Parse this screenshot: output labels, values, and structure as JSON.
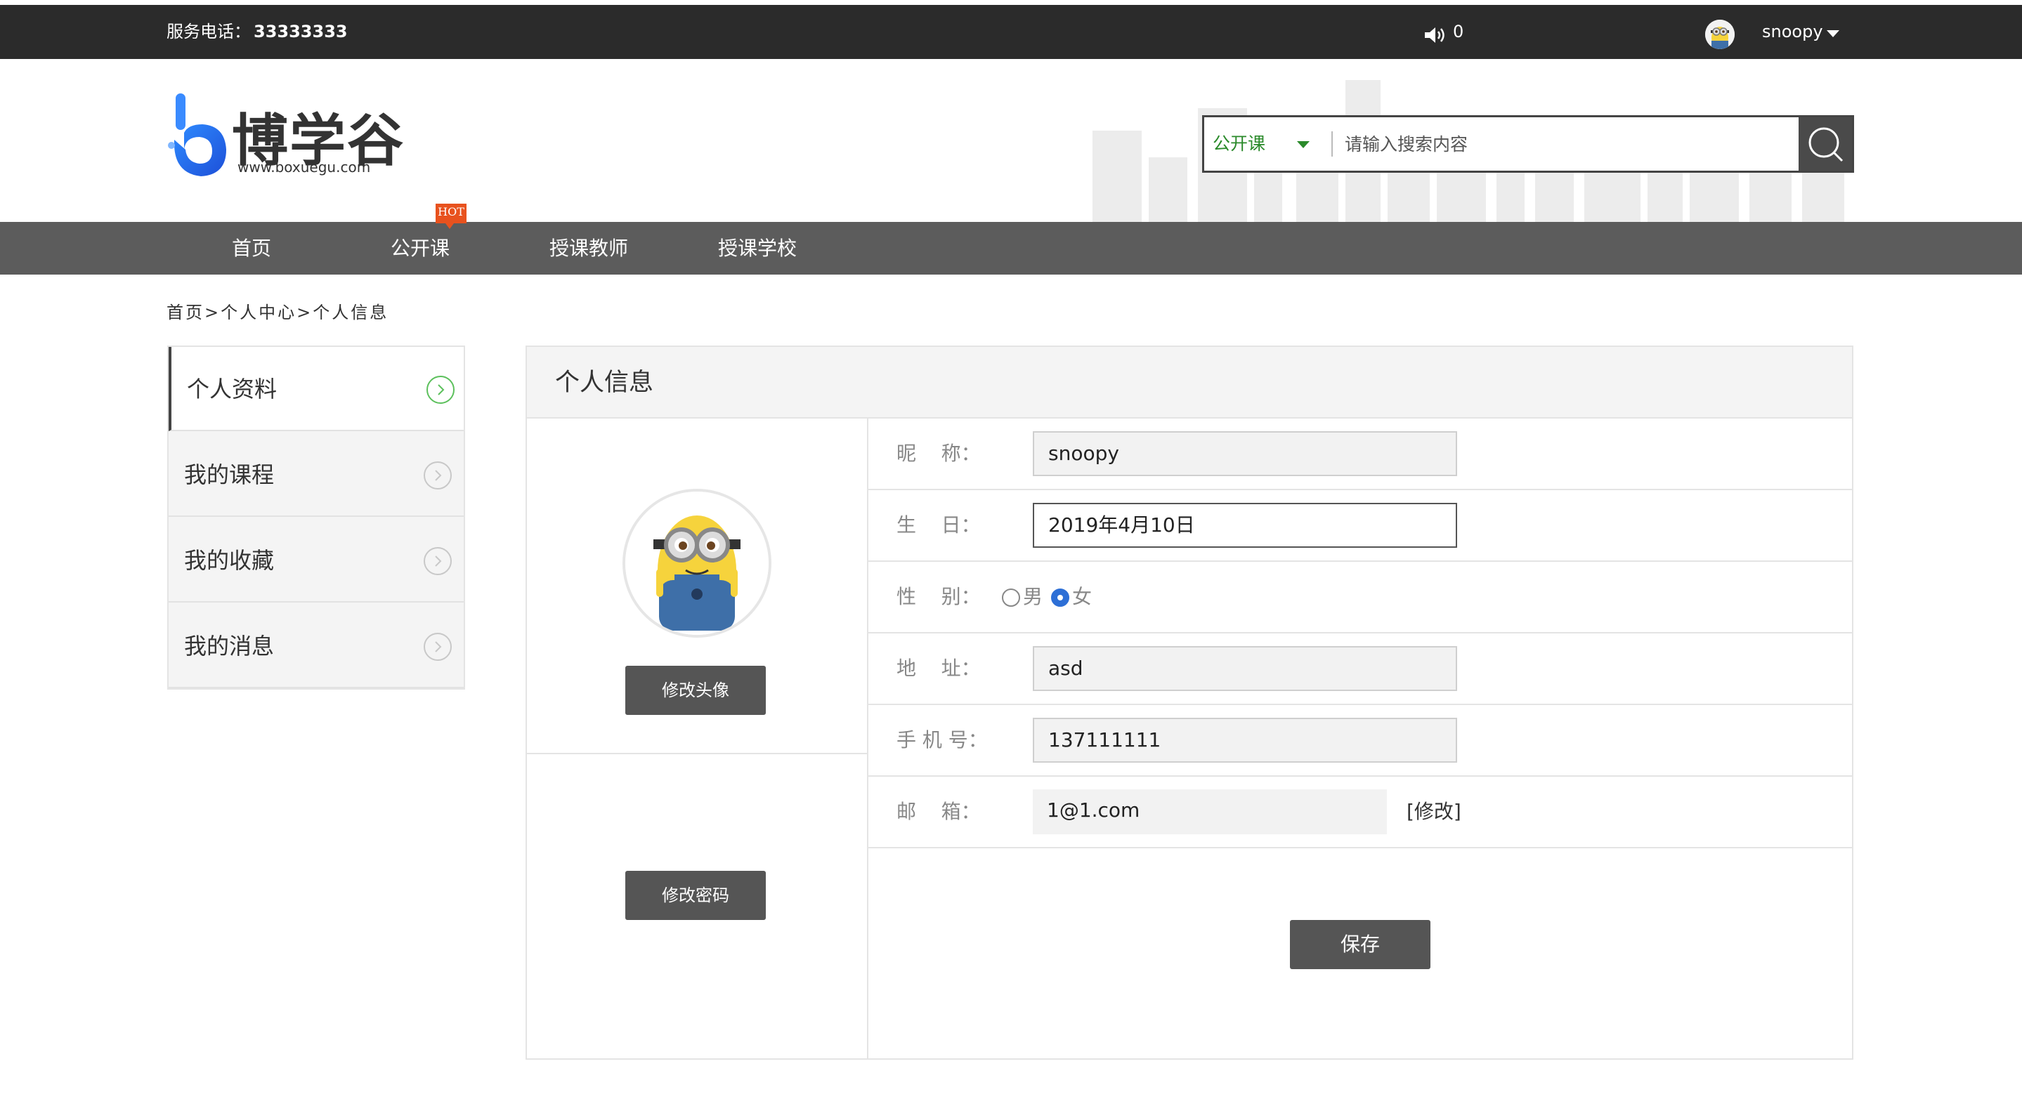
{
  "topbar": {
    "phone_label": "服务电话：",
    "phone_number": "33333333",
    "message_count": "0",
    "username": "snoopy",
    "icons": [
      "speaker-icon",
      "avatar",
      "caret-down-icon"
    ]
  },
  "header": {
    "logo_text": "博学谷",
    "logo_url": "www.boxuegu.com",
    "search": {
      "category": "公开课",
      "placeholder": "请输入搜索内容",
      "button_icon": "search-icon"
    }
  },
  "nav": {
    "items": [
      "首页",
      "公开课",
      "授课教师",
      "授课学校"
    ],
    "hot_badge": "HOT"
  },
  "breadcrumb": "首页>个人中心>个人信息",
  "sidebar": {
    "items": [
      {
        "label": "个人资料",
        "active": true
      },
      {
        "label": "我的课程",
        "active": false
      },
      {
        "label": "我的收藏",
        "active": false
      },
      {
        "label": "我的消息",
        "active": false
      }
    ]
  },
  "panel": {
    "title": "个人信息",
    "change_avatar": "修改头像",
    "change_password": "修改密码",
    "fields": {
      "nickname": {
        "label": "昵    称：",
        "value": "snoopy"
      },
      "birthday": {
        "label": "生    日：",
        "value": "2019年4月10日"
      },
      "gender": {
        "label": "性    别：",
        "options": [
          "男",
          "女"
        ],
        "selected": "女"
      },
      "address": {
        "label": "地    址：",
        "value": "asd"
      },
      "phone": {
        "label": "手 机 号：",
        "value": "137111111"
      },
      "email": {
        "label": "邮    箱：",
        "value": "1@1.com",
        "edit": "[修改]"
      }
    },
    "save": "保存"
  },
  "colors": {
    "topbar": "#2b2b2b",
    "nav": "#5c5c5c",
    "accent_green": "#2a8a2a",
    "hot": "#e8521e",
    "radio_checked": "#2d6fd6"
  }
}
